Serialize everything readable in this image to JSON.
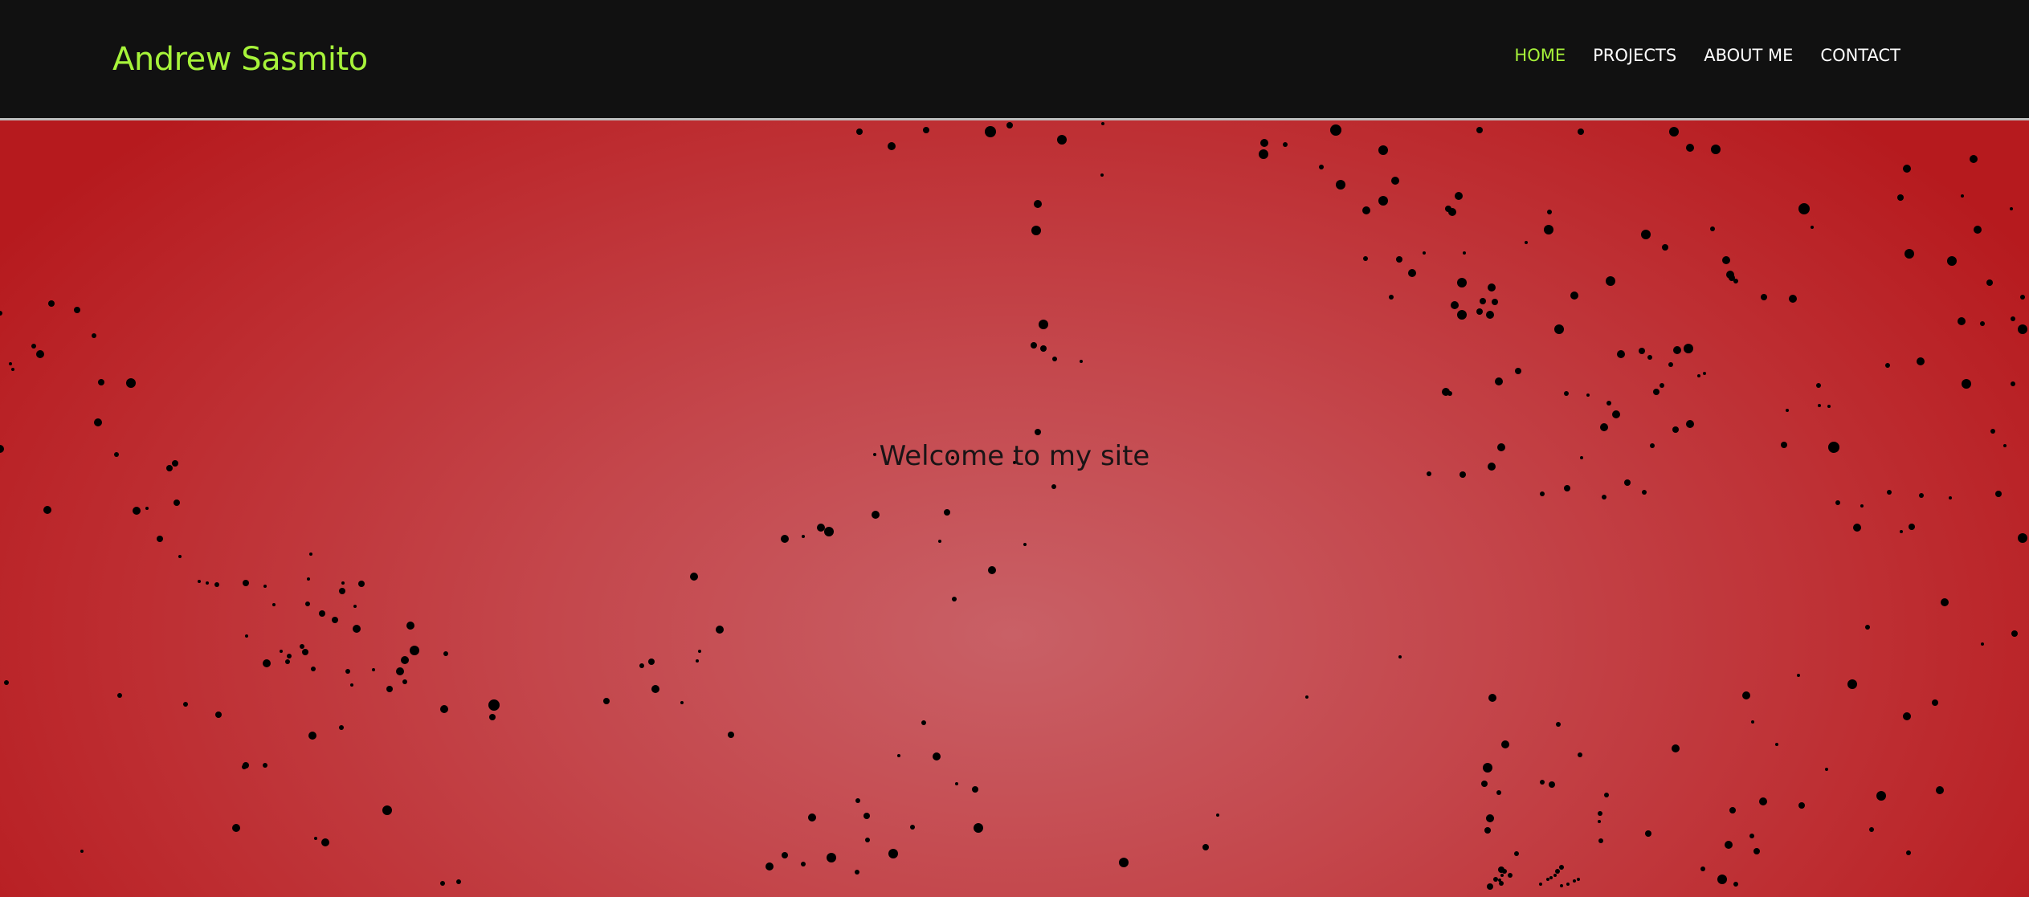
{
  "header": {
    "brand": "Andrew Sasmito",
    "nav": [
      {
        "label": "HOME",
        "active": true
      },
      {
        "label": "PROJECTS",
        "active": false
      },
      {
        "label": "ABOUT ME",
        "active": false
      },
      {
        "label": "CONTACT",
        "active": false
      }
    ]
  },
  "hero": {
    "welcome_text": "Welcome to my site"
  },
  "colors": {
    "header_background": "#111111",
    "brand": "#a7f33a",
    "nav_active": "#a7f33a",
    "nav_text": "#ffffff",
    "hero_center": "#c96066",
    "hero_edge": "#b61a1e",
    "particle": "#000000"
  }
}
